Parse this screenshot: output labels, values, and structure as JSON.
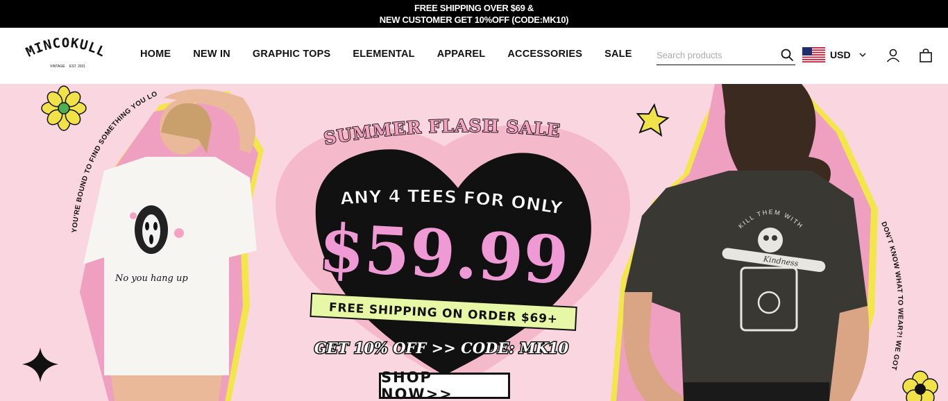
{
  "announcement": {
    "line1": "FREE SHIPPING OVER $69 &",
    "line2": "NEW CUSTOMER GET 10%OFF (CODE:MK10)"
  },
  "header": {
    "logo_text": "MINCOKULL",
    "logo_sub_left": "VINTAGE",
    "logo_sub_right": "EST. 2021",
    "nav": [
      "HOME",
      "NEW IN",
      "GRAPHIC TOPS",
      "ELEMENTAL",
      "APPAREL",
      "ACCESSORIES",
      "SALE"
    ],
    "search_placeholder": "Search products",
    "currency": "USD",
    "icons": [
      "search-icon",
      "us-flag-icon",
      "chevron-down-icon",
      "account-icon",
      "cart-icon"
    ]
  },
  "hero": {
    "title": "SUMMER FLASH SALE",
    "offer_line": "ANY 4 TEES FOR ONLY",
    "price": "$59.99",
    "shipping_banner": "FREE SHIPPING ON ORDER $69+",
    "code_line": "GET 10% OFF >> CODE: MK10",
    "cta": "SHOP NOW>>",
    "left_curved_text": "YOU'RE BOUND TO FIND SOMETHING YOU LOVE BABE!",
    "right_curved_text": "DON'T KNOW WHAT TO WEAR?! WE GOT YOU!",
    "left_shirt_text": "No you hang up",
    "right_shirt_text_top": "KILL THEM WITH",
    "right_shirt_text_bottom": "Kindness",
    "colors": {
      "background": "#f9d6e0",
      "heart_outer": "#f4b9cb",
      "price_pink": "#f09ad5",
      "banner_green": "#e6f7a6",
      "accent_yellow": "#f3e24a"
    }
  }
}
